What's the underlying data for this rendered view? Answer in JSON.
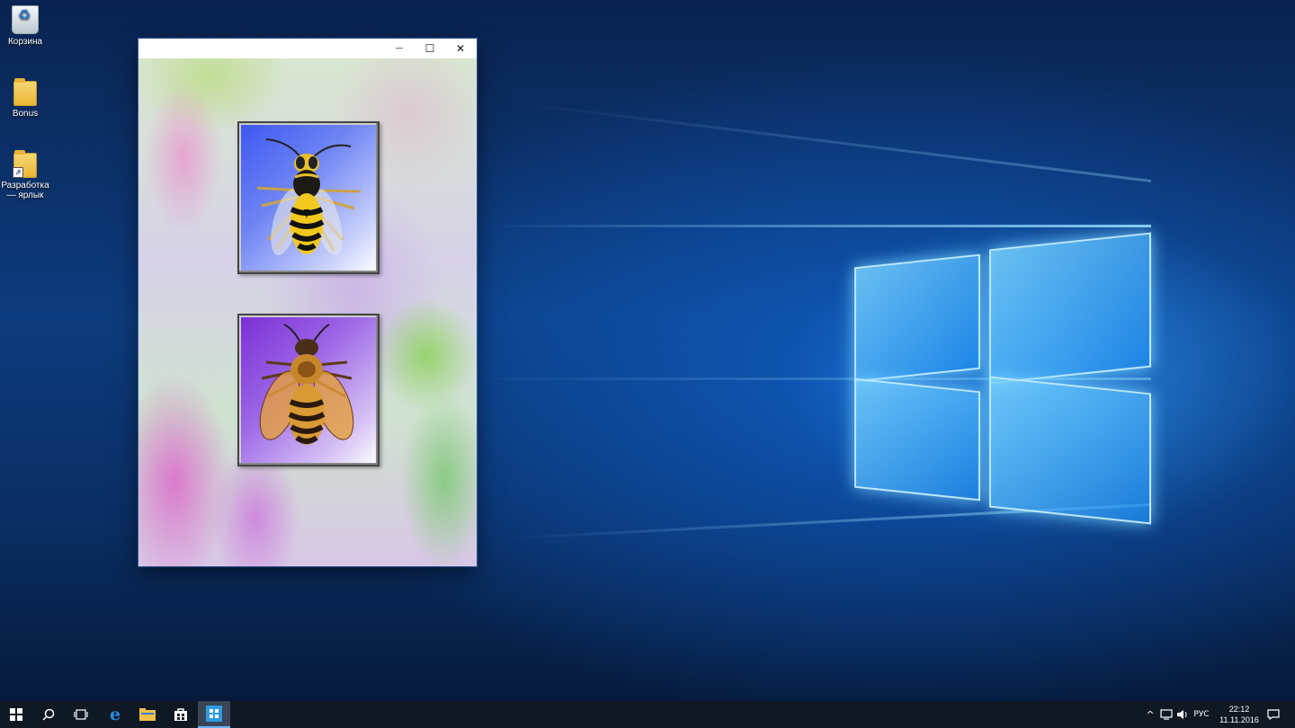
{
  "desktop": {
    "icons": [
      {
        "label": "Корзина",
        "icon": "recycle-bin-icon"
      },
      {
        "label": "Bonus",
        "icon": "folder-icon"
      },
      {
        "label": "Разработка — ярлык",
        "icon": "folder-shortcut-icon"
      }
    ]
  },
  "window": {
    "title": "",
    "controls": {
      "minimize": "—",
      "maximize": "☐",
      "close": "✕"
    },
    "cards": [
      {
        "name": "wasp",
        "icon": "wasp-image",
        "gradient_start": "#3d57f2"
      },
      {
        "name": "bee",
        "icon": "bee-image",
        "gradient_start": "#7b2fd6"
      }
    ]
  },
  "taskbar": {
    "apps": [
      "start-icon",
      "search-icon",
      "task-view-icon",
      "edge-icon",
      "file-explorer-icon",
      "store-icon",
      "active-app-icon"
    ],
    "tray": {
      "chevron": "^",
      "language": "РУС",
      "time": "22:12",
      "date": "11.11.2016"
    }
  },
  "colors": {
    "accent": "#2f7fe0",
    "taskbar": "#101824",
    "active_indicator": "#6ab0ff"
  }
}
